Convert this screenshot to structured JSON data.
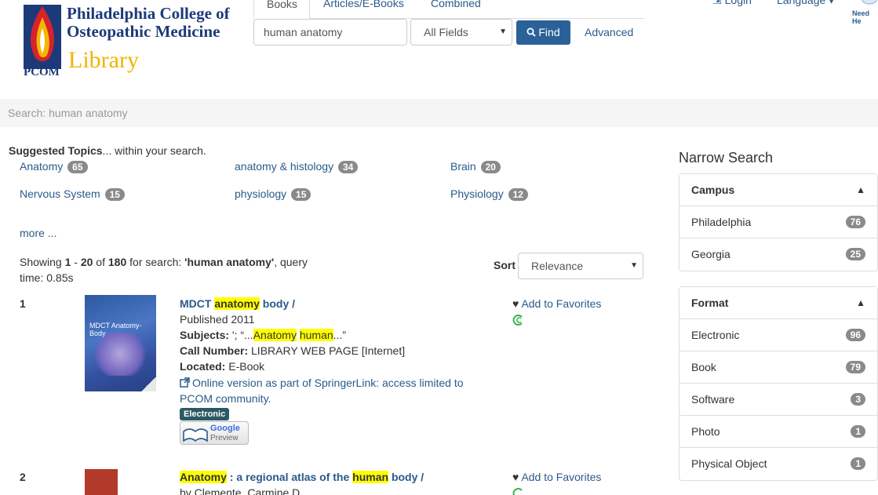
{
  "header": {
    "logo_line1": "Philadelphia College of",
    "logo_line2": "Osteopathic Medicine",
    "logo_library": "Library",
    "logo_abbr": "PCOM",
    "tabs": [
      {
        "label": "Books"
      },
      {
        "label": "Articles/E-Books"
      },
      {
        "label": "Combined"
      }
    ],
    "search_value": "human anatomy",
    "field_select": "All Fields",
    "find_label": "Find",
    "advanced_label": "Advanced",
    "login_label": "Login",
    "language_label": "Language",
    "need_help": "Need He"
  },
  "breadcrumb": "Search: human anatomy",
  "suggested": {
    "title": "Suggested Topics",
    "suffix": "... within your search.",
    "topics": [
      {
        "label": "Anatomy",
        "count": "65"
      },
      {
        "label": "anatomy & histology",
        "count": "34"
      },
      {
        "label": "Brain",
        "count": "20"
      },
      {
        "label": "Nervous System",
        "count": "15"
      },
      {
        "label": "physiology",
        "count": "15"
      },
      {
        "label": "Physiology",
        "count": "12"
      }
    ],
    "more": "more ..."
  },
  "summary": {
    "showing": "Showing ",
    "start": "1",
    "dash": " - ",
    "end": "20",
    "of": " of ",
    "total": "180",
    "for": " for search: ",
    "query": "'human anatomy'",
    "query_time": ", query time: 0.85s"
  },
  "sort": {
    "label": "Sort",
    "value": "Relevance"
  },
  "results": [
    {
      "num": "1",
      "title_parts": [
        "MDCT ",
        "anatomy",
        " body /"
      ],
      "published": "Published 2011",
      "subjects_label": "Subjects:",
      "subjects_pre": " '; “...",
      "subjects_hl1": "Anatomy",
      "subjects_mid": " ",
      "subjects_hl2": "human",
      "subjects_post": "...”",
      "call_label": "Call Number:",
      "call_value": " LIBRARY WEB PAGE [Internet]",
      "located_label": "Located:",
      "located_value": " E-Book",
      "online": "Online version as part of SpringerLink: access limited to PCOM community.",
      "format_label": "Electronic",
      "cover_title": "MDCT Anatomy-Body",
      "google": "Google",
      "preview": "Preview",
      "favorite": "Add to Favorites"
    },
    {
      "num": "2",
      "title_hl1": "Anatomy",
      "title_mid": " : a regional atlas of the ",
      "title_hl2": "human",
      "title_end": " body /",
      "author": "by Clemente, Carmine D.",
      "favorite": "Add to Favorites"
    }
  ],
  "sidebar": {
    "title": "Narrow Search",
    "campus": {
      "title": "Campus",
      "items": [
        {
          "label": "Philadelphia",
          "count": "76"
        },
        {
          "label": "Georgia",
          "count": "25"
        }
      ]
    },
    "format": {
      "title": "Format",
      "items": [
        {
          "label": "Electronic",
          "count": "96"
        },
        {
          "label": "Book",
          "count": "79"
        },
        {
          "label": "Software",
          "count": "3"
        },
        {
          "label": "Photo",
          "count": "1"
        },
        {
          "label": "Physical Object",
          "count": "1"
        }
      ]
    }
  },
  "colors": {
    "brand_blue": "#1c3a7a",
    "link": "#2a5a8c",
    "find_button": "#2b6199",
    "highlight": "#ffff00",
    "library_gold": "#f0b400"
  }
}
